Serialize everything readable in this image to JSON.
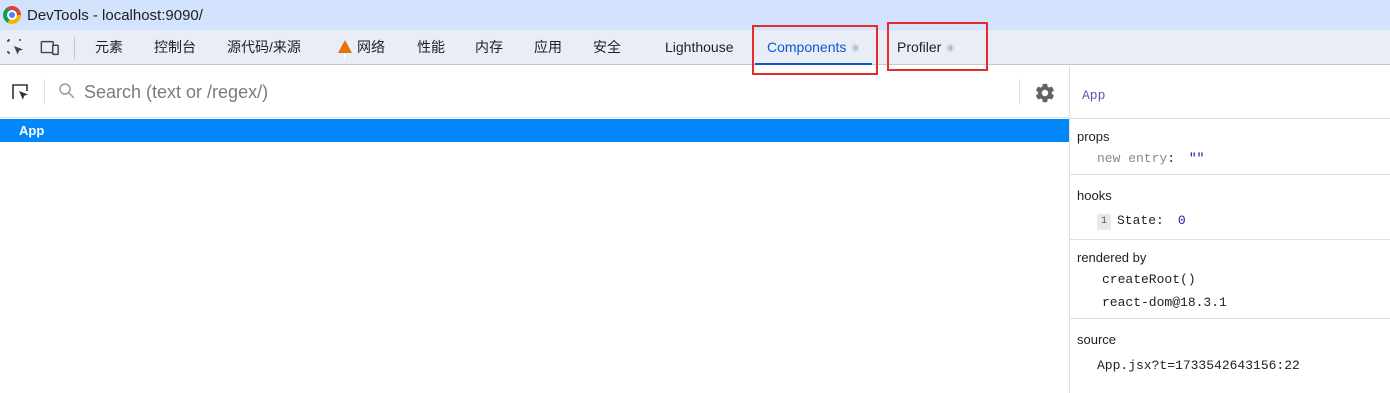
{
  "window": {
    "title": "DevTools - localhost:9090/"
  },
  "toolbar": {
    "select_icon": "select-element-icon",
    "device_icon": "device-toggle-icon"
  },
  "tabs": [
    {
      "label": "元素"
    },
    {
      "label": "控制台"
    },
    {
      "label": "源代码/来源"
    },
    {
      "label": "网络",
      "icon": "warning-icon"
    },
    {
      "label": "性能"
    },
    {
      "label": "内存"
    },
    {
      "label": "应用"
    },
    {
      "label": "安全"
    },
    {
      "label": "Lighthouse"
    },
    {
      "label": "Components",
      "active": true,
      "glyph": "⚛"
    },
    {
      "label": "Profiler",
      "glyph": "⚛"
    }
  ],
  "search": {
    "placeholder": "Search (text or /regex/)",
    "value": ""
  },
  "tree": {
    "rows": [
      {
        "label": "App",
        "selected": true
      }
    ]
  },
  "inspector": {
    "component_name": "App",
    "props": {
      "title": "props",
      "key": "new entry",
      "value": "\"\""
    },
    "hooks": {
      "title": "hooks",
      "index": "1",
      "key": "State",
      "value": "0"
    },
    "rendered_by": {
      "title": "rendered by",
      "items": [
        "createRoot()",
        "react-dom@18.3.1"
      ]
    },
    "source": {
      "title": "source",
      "value": "App.jsx?t=1733542643156:22"
    }
  },
  "colors": {
    "accent": "#0b57d0",
    "selection": "#0088fa",
    "highlight": "#e52b2b"
  }
}
